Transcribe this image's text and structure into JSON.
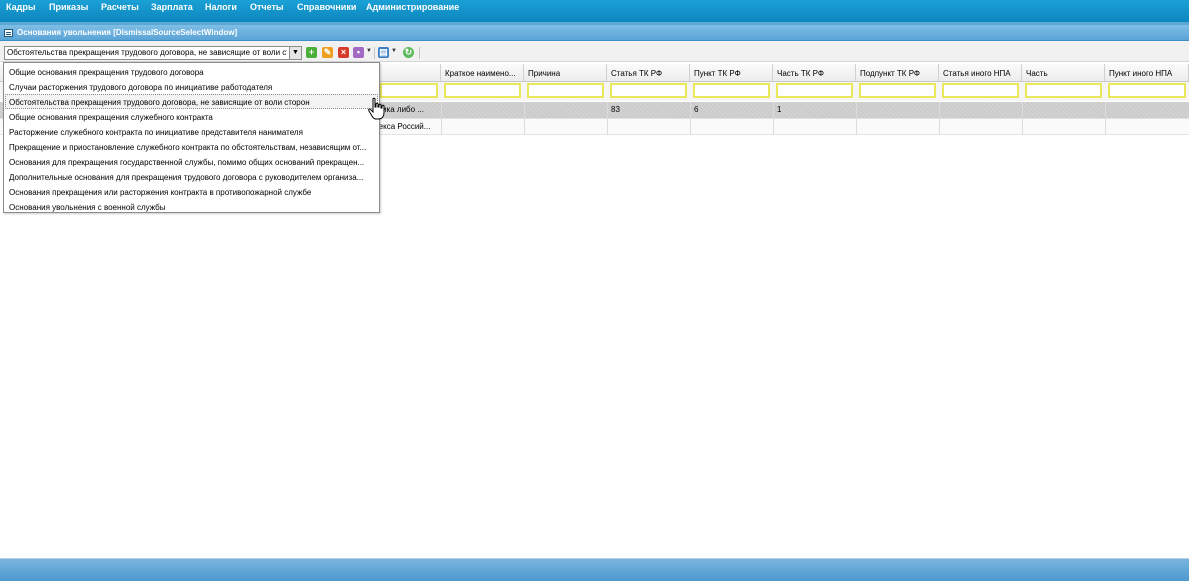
{
  "menu": {
    "items": [
      "Кадры",
      "Приказы",
      "Расчеты",
      "Зарплата",
      "Налоги",
      "Отчеты",
      "Справочники",
      "Администрирование"
    ]
  },
  "window": {
    "title": "Основания увольнения [DismissalSourceSelectWindow]"
  },
  "toolbar": {
    "combo_value": "Обстоятельства прекращения трудового договора, не зависящие от воли сторон"
  },
  "grid": {
    "columns": [
      "Краткое наимено...",
      "Причина",
      "Статья ТК РФ",
      "Пункт ТК РФ",
      "Часть ТК РФ",
      "Подпункт ТК РФ",
      "Статья иного НПА",
      "Часть",
      "Пункт иного НПА"
    ],
    "row1": {
      "name_tail": "тника либо ...",
      "article": "83",
      "point": "6",
      "part": "1"
    },
    "row2": {
      "name_tail": "декса Россий..."
    }
  },
  "dropdown": {
    "options": [
      "Общие основания прекращения трудового договора",
      "Случаи расторжения трудового договора по инициативе работодателя",
      "Обстоятельства прекращения трудового договора, не зависящие от воли сторон",
      "Общие основания прекращения служебного контракта",
      "Расторжение служебного контракта по инициативе представителя нанимателя",
      "Прекращение и приостановление служебного контракта по обстоятельствам, независящим от...",
      "Основания для прекращения государственной службы, помимо общих оснований прекращен...",
      "Дополнительные основания для прекращения трудового договора с руководителем организа...",
      "Основания прекращения или расторжения контракта в противопожарной службе",
      "Основания увольнения с военной службы"
    ],
    "selected_index": 2
  }
}
